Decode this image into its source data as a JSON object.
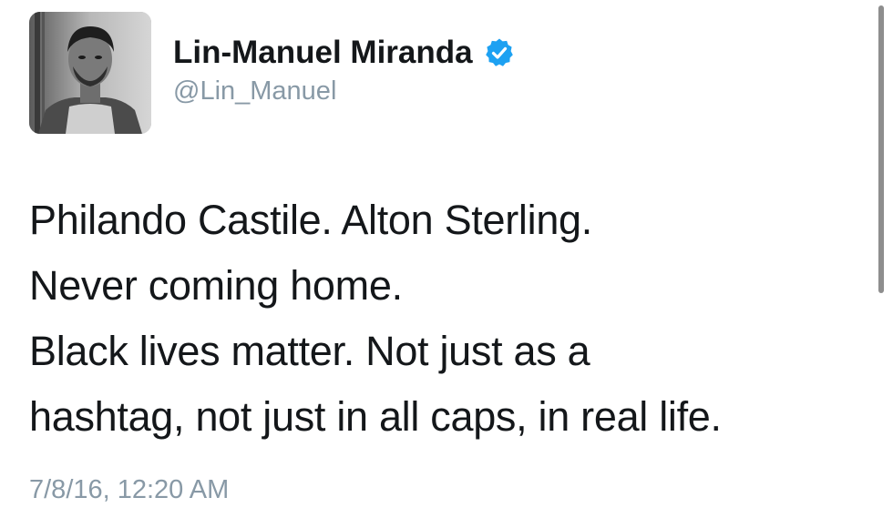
{
  "tweet": {
    "display_name": "Lin-Manuel Miranda",
    "verified": true,
    "handle": "@Lin_Manuel",
    "text_lines": [
      "Philando Castile. Alton Sterling.",
      "Never coming home.",
      "Black lives matter. Not just as a",
      "hashtag, not just in all caps, in real life."
    ],
    "timestamp": "7/8/16, 12:20 AM"
  },
  "colors": {
    "verified_badge": "#1da1f2",
    "secondary_text": "#8899a6",
    "primary_text": "#14171a"
  },
  "icons": {
    "verified": "verified-badge-icon"
  }
}
